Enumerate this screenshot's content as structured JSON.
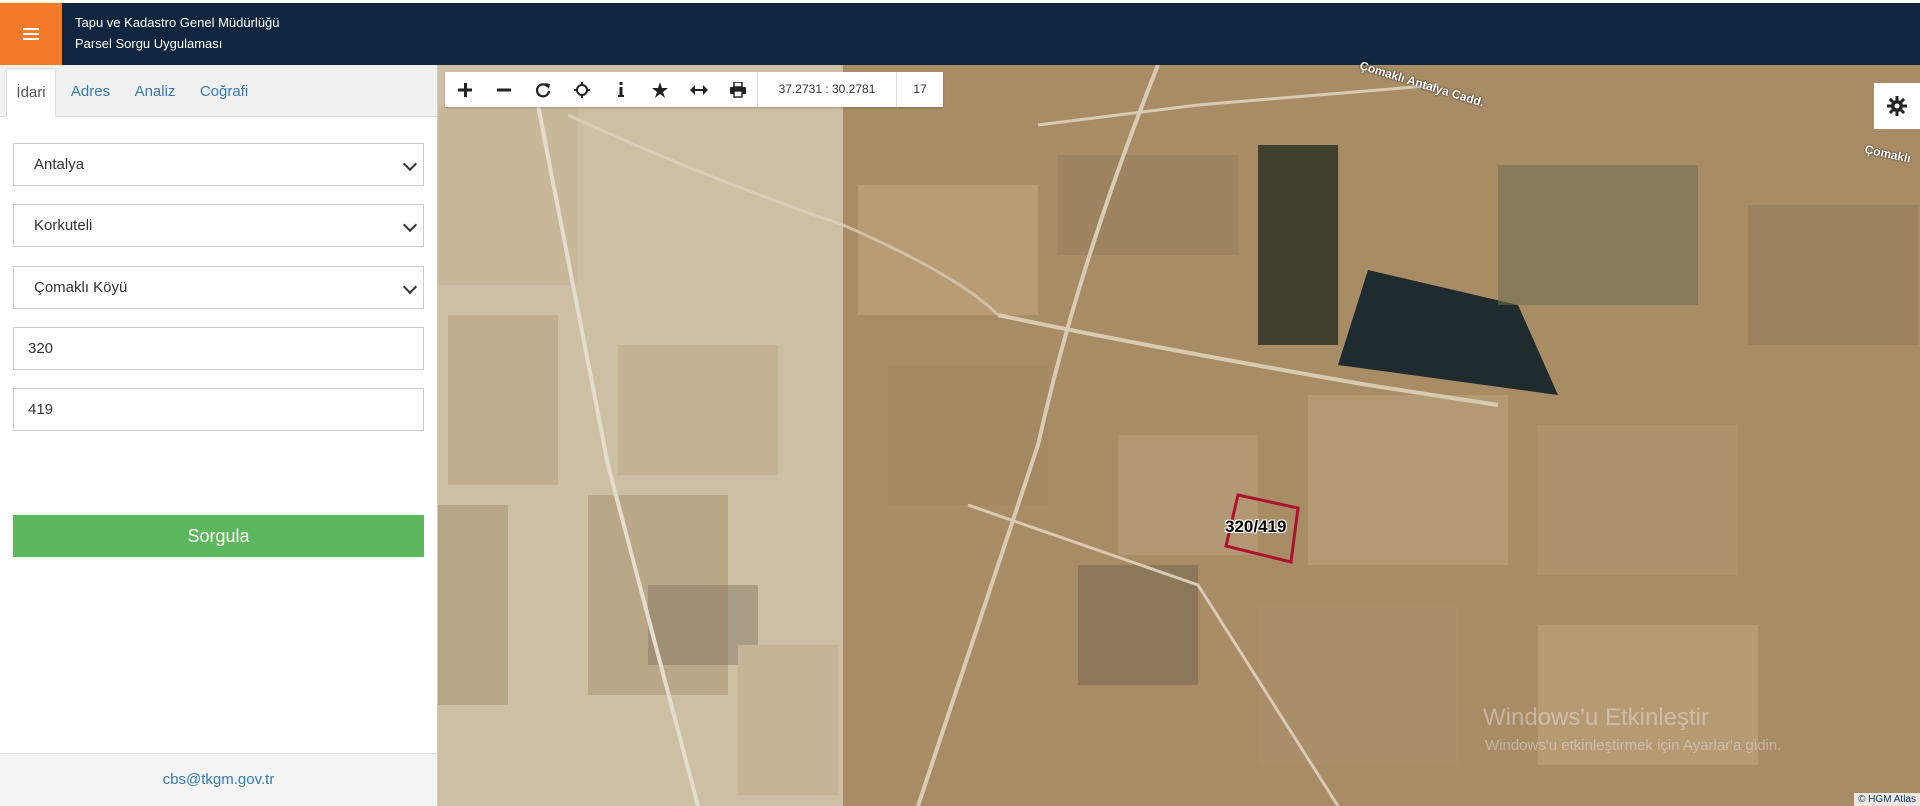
{
  "header": {
    "line1": "Tapu ve Kadastro Genel Müdürlüğü",
    "line2": "Parsel Sorgu Uygulaması",
    "menu_icon": "hamburger-icon"
  },
  "sidebar": {
    "tabs": [
      "İdari",
      "Adres",
      "Analiz",
      "Coğrafi"
    ],
    "active_tab": "İdari",
    "province": "Antalya",
    "district": "Korkuteli",
    "neighborhood": "Çomaklı Köyü",
    "block_no": "320",
    "parcel_no": "419",
    "query_label": "Sorgula",
    "footer_email": "cbs@tkgm.gov.tr"
  },
  "map": {
    "coordinates": "37.2731 : 30.2781",
    "zoom_level": "17",
    "parcel_label": "320/419",
    "street_name_1": "Çomaklı Antalya Cadd.",
    "street_name_2": "Çomaklı",
    "watermark_title": "Windows'u Etkinleştir",
    "watermark_sub": "Windows'u etkinleştirmek için Ayarlar'a gidin.",
    "attribution": "© HGM Atlas",
    "tools": [
      "zoom-in-icon",
      "zoom-out-icon",
      "refresh-icon",
      "locate-icon",
      "info-icon",
      "star-icon",
      "measure-icon",
      "print-icon"
    ]
  },
  "colors": {
    "header_bg": "#0f263e",
    "menu_btn": "#f47a2a",
    "query_btn": "#5cb85c",
    "parcel_outline": "#b01030"
  }
}
